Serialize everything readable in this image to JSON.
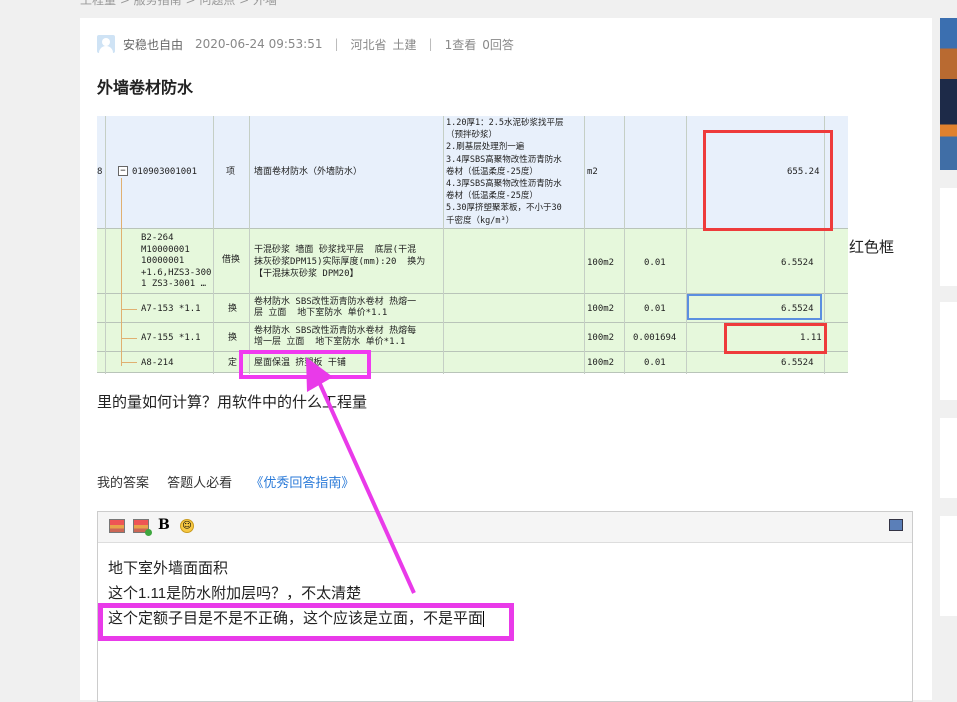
{
  "breadcrumb": "工程量 > 服务指南 > 问题点 > 外墙",
  "post": {
    "author": "安稳也自由",
    "time": "2020-06-24 09:53:51",
    "location": "河北省",
    "category": "土建",
    "views": "1查看",
    "answers": "0回答",
    "title": "外墙卷材防水",
    "question_tail": "红色框",
    "question_line2": "里的量如何计算？用软件中的什么工程量"
  },
  "screenshot": {
    "r1": {
      "marker": "8",
      "code": "010903001001",
      "kind": "项",
      "name": "墙面卷材防水（外墙防水）",
      "desc": "1.20厚1：2.5水泥砂浆找平层\n（预拌砂浆）\n2.刷基层处理剂一遍\n3.4厚SBS高聚物改性沥青防水\n卷材（低温柔度-25度）\n4.3厚SBS高聚物改性沥青防水\n卷材（低温柔度-25度）\n5.30厚挤塑聚苯板，不小于30\n千密度（kg/m³）",
      "unit": "m2",
      "qty": "655.24"
    },
    "r2": {
      "code": "B2-264\nM10000001\n10000001\n+1.6,HZS3-300\n1 ZS3-3001 …",
      "kind": "借换",
      "name": "干混砂浆 墙面 砂浆找平层  底层(干混\n抹灰砂浆DPM15)实际厚度(mm):20  换为\n【干混抹灰砂浆 DPM20】",
      "unit": "100m2",
      "coef": "0.01",
      "qty": "6.5524"
    },
    "r3": {
      "code": "A7-153 *1.1",
      "kind": "换",
      "name": "卷材防水 SBS改性沥青防水卷材 热熔一\n层 立面  地下室防水 单价*1.1",
      "unit": "100m2",
      "coef": "0.01",
      "qty": "6.5524"
    },
    "r4": {
      "code": "A7-155 *1.1",
      "kind": "换",
      "name": "卷材防水 SBS改性沥青防水卷材 热熔每\n增一层 立面  地下室防水 单价*1.1",
      "unit": "100m2",
      "coef": "0.001694",
      "qty": "1.11"
    },
    "r5": {
      "code": "A8-214",
      "kind": "定",
      "name": "屋面保温 挤塑板 干铺",
      "unit": "100m2",
      "coef": "0.01",
      "qty": "6.5524"
    }
  },
  "answer": {
    "my_answer": "我的答案",
    "must_see": "答题人必看",
    "guide": "《优秀回答指南》",
    "lines": [
      "地下室外墙面面积",
      "这个1.11是防水附加层吗？，不太清楚",
      "这个定额子目是不是不正确，这个应该是立面，不是平面"
    ]
  },
  "colors": {
    "red_box": "#ee3b3b",
    "magenta_annotation": "#e93ae9",
    "link": "#2a7ad8"
  }
}
